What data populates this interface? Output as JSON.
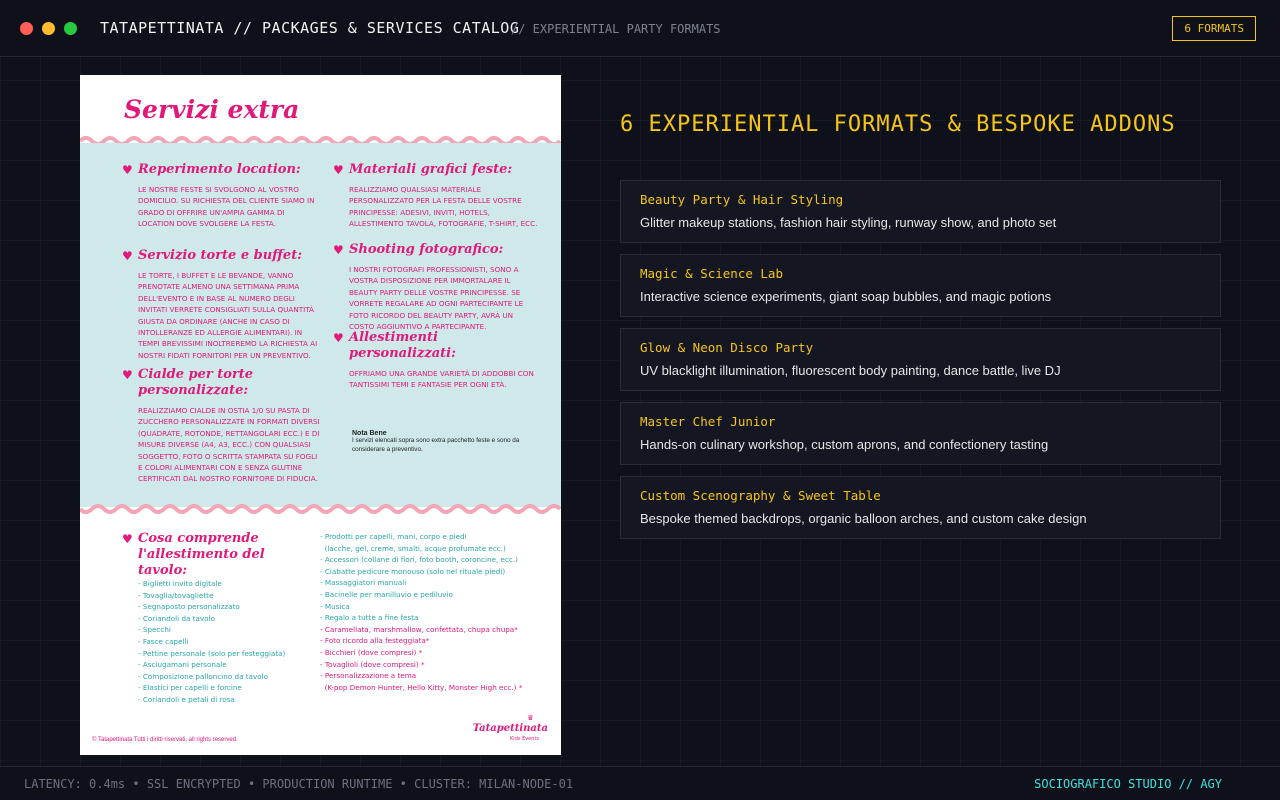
{
  "window": {
    "title": "TATAPETTINATA // PACKAGES & SERVICES CATALOG",
    "subtitle": "// EXPERIENTIAL PARTY FORMATS",
    "badge": "6 FORMATS"
  },
  "document": {
    "title": "Servizi extra",
    "sections": [
      {
        "heading": "Reperimento location:",
        "text": "Le nostre feste si svolgono al vostro domicilio. Su richiesta del cliente siamo in grado di offrire un'ampia gamma di location dove svolgere la festa."
      },
      {
        "heading": "Servizio torte e buffet:",
        "text": "Le torte, i buffet e le bevande, vanno prenotate almeno una settimana prima dell'evento e in base al numero degli invitati verrete consigliati sulla quantità giusta da ordinare (anche in caso di intolleranze ed allergie alimentari). In tempi brevissimi inoltreremo la richiesta ai nostri fidati fornitori per un preventivo."
      },
      {
        "heading": "Cialde per torte personalizzate:",
        "text": "Realizziamo cialde in ostia 1/0 su pasta di zucchero personalizzate in formati diversi (quadrate, rotonde, rettangolari ecc.) e di misure diverse (A4, A3, ecc.) con qualsiasi soggetto, foto o scritta stampata su fogli e colori alimentari con e senza glutine certificati dal nostro fornitore di fiducia."
      },
      {
        "heading": "Materiali grafici feste:",
        "text": "Realizziamo qualsiasi materiale personalizzato per la festa delle vostre principesse: adesivi, inviti, hotels, allestimento tavola, fotografie, t-shirt, ecc."
      },
      {
        "heading": "Shooting fotografico:",
        "text": "I nostri fotografi professionisti, sono a vostra disposizione per immortalare il Beauty Party delle vostre principesse. Se vorrete regalare ad ogni partecipante le foto ricordo del beauty party, avrà un costo aggiuntivo a partecipante."
      },
      {
        "heading": "Allestimenti personalizzati:",
        "text": "Offriamo una grande varietà di addobbi con tantissimi temi e fantasie per ogni età."
      }
    ],
    "note_heading": "Nota Bene",
    "note_text": "I servizi elencati sopra sono extra pacchetto feste e sono da considerare a preventivo.",
    "table_heading": "Cosa comprende l'allestimento del tavolo:",
    "list_left": [
      "- Biglietti invito digitale",
      "- Tovaglia/tovagliette",
      "- Segnaposto personalizzato",
      "- Coriandoli da tavolo",
      "- Specchi",
      "- Fasce capelli",
      "- Pettine personale (solo per festeggiata)",
      "- Asciugamani personale",
      "- Composizione palloncino da tavolo",
      "- Elastici per capelli e forcine",
      "- Coriandoli e petali di rosa"
    ],
    "list_right_teal": [
      "- Prodotti per capelli, mani, corpo e piedi",
      "  (lacche, gel, creme, smalti, acque profumate ecc.)",
      "- Accessori (collane di fiori, foto booth, coroncine, ecc.)",
      "- Ciabatte pedicure monouso (solo nel rituale piedi)",
      "- Massaggiatori manuali",
      "- Bacinelle per manilluvio e pediluvio",
      "- Musica",
      "- Regalo a tutte a fine festa"
    ],
    "list_right_pink": [
      "- Caramellata, marshmallow, confettata, chupa chupa*",
      "- Foto ricordo alla festeggiata*",
      "- Bicchieri (dove compresi) *",
      "- Tovaglioli (dove compresi) *",
      "- Personalizzazione a tema",
      "  (K-pop Demon Hunter, Hello Kitty, Monster High ecc.) *"
    ],
    "logo": "Tatapettinata",
    "logo_sub": "Kids Events",
    "copyright": "© Tatapettinata Tutti i diritti riservati, all rights reserved."
  },
  "catalog": {
    "heading": "6 EXPERIENTIAL FORMATS & BESPOKE ADDONS",
    "items": [
      {
        "title": "Beauty Party & Hair Styling",
        "desc": "Glitter makeup stations, fashion hair styling, runway show, and photo set"
      },
      {
        "title": "Magic & Science Lab",
        "desc": "Interactive science experiments, giant soap bubbles, and magic potions"
      },
      {
        "title": "Glow & Neon Disco Party",
        "desc": "UV blacklight illumination, fluorescent body painting, dance battle, live DJ"
      },
      {
        "title": "Master Chef Junior",
        "desc": "Hands-on culinary workshop, custom aprons, and confectionery tasting"
      },
      {
        "title": "Custom Scenography & Sweet Table",
        "desc": "Bespoke themed backdrops, organic balloon arches, and custom cake design"
      }
    ]
  },
  "footer": {
    "status": "LATENCY: 0.4ms • SSL ENCRYPTED • PRODUCTION RUNTIME • CLUSTER: MILAN-NODE-01",
    "brand": "SOCIOGRAFICO STUDIO // AGY"
  },
  "colors": {
    "accent": "#f5c518",
    "cyan": "#3fe0e0",
    "pink": "#e0197a",
    "teal": "#2aa6a8"
  }
}
